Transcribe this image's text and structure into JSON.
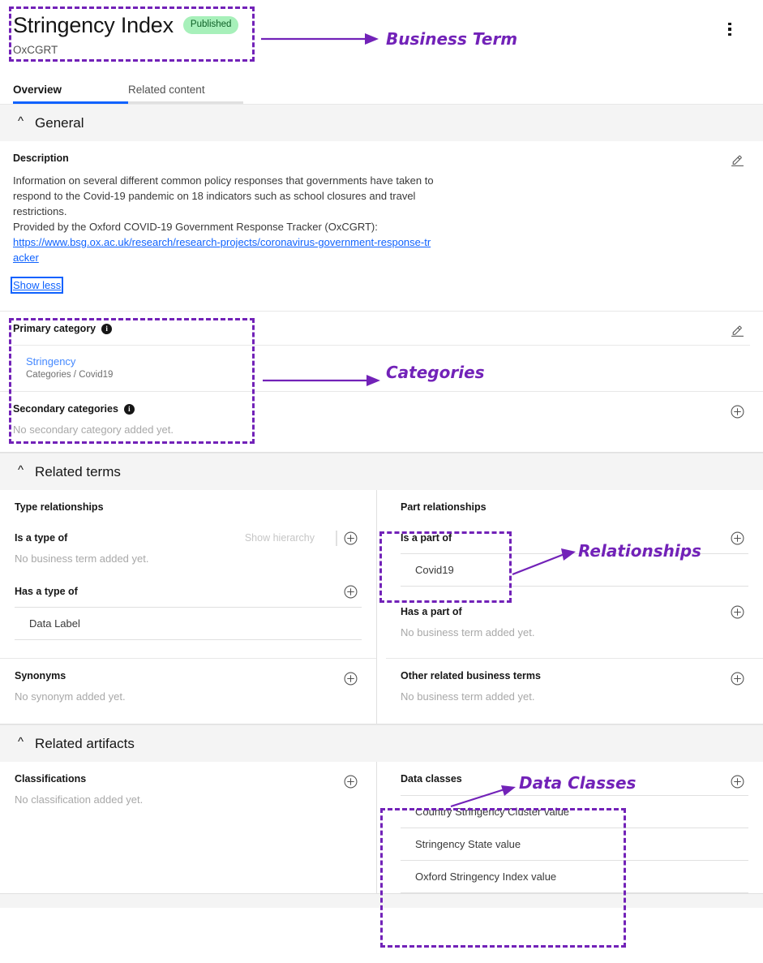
{
  "header": {
    "title": "Stringency Index",
    "status_badge": "Published",
    "subtitle": "OxCGRT",
    "overflow_menu_icon": "kebab-menu-icon"
  },
  "tabs": [
    {
      "label": "Overview",
      "active": true
    },
    {
      "label": "Related content",
      "active": false
    }
  ],
  "sections": {
    "general": {
      "title": "General",
      "description_label": "Description",
      "description_paragraph_1": "Information on several different common policy responses that governments have taken to respond to the Covid-19 pandemic on 18 indicators such as school closures and travel restrictions.",
      "description_paragraph_2": "Provided by the Oxford COVID-19 Government Response Tracker (OxCGRT):",
      "description_link": "https://www.bsg.ox.ac.uk/research/research-projects/coronavirus-government-response-tracker",
      "show_less_label": "Show less",
      "primary_category_label": "Primary category",
      "primary_category_name": "Stringency",
      "primary_category_path": "Categories  /  Covid19",
      "secondary_categories_label": "Secondary categories",
      "secondary_categories_empty": "No secondary category added yet."
    },
    "related_terms": {
      "title": "Related terms",
      "type_relationships_label": "Type relationships",
      "part_relationships_label": "Part relationships",
      "is_a_type_of_label": "Is a type of",
      "is_a_type_of_empty": "No business term added yet.",
      "show_hierarchy_label": "Show hierarchy",
      "has_a_type_of_label": "Has a type of",
      "has_a_type_of_items": [
        "Data Label"
      ],
      "is_a_part_of_label": "Is a part of",
      "is_a_part_of_items": [
        "Covid19"
      ],
      "has_a_part_of_label": "Has a part of",
      "has_a_part_of_empty": "No business term added yet.",
      "synonyms_label": "Synonyms",
      "synonyms_empty": "No synonym added yet.",
      "other_related_label": "Other related business terms",
      "other_related_empty": "No business term added yet."
    },
    "related_artifacts": {
      "title": "Related artifacts",
      "classifications_label": "Classifications",
      "classifications_empty": "No classification added yet.",
      "data_classes_label": "Data classes",
      "data_classes_items": [
        "Country Stringency Cluster value",
        "Stringency State value",
        "Oxford Stringency Index value"
      ]
    }
  },
  "annotations": [
    {
      "text": "Business Term"
    },
    {
      "text": "Categories"
    },
    {
      "text": "Relationships"
    },
    {
      "text": "Data Classes"
    }
  ],
  "colors": {
    "annotation": "#7222b8",
    "accent_blue": "#0f62fe",
    "badge_bg": "#a7f0ba",
    "badge_text": "#0e6027",
    "section_bg": "#f4f4f4"
  }
}
